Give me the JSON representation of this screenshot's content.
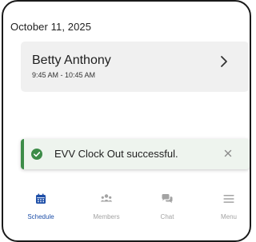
{
  "date_header": "October 11, 2025",
  "appointment": {
    "name": "Betty Anthony",
    "time": "9:45 AM - 10:45 AM",
    "chevron_icon": "chevron-right-icon"
  },
  "toast": {
    "message": "EVV Clock Out successful.",
    "status_icon": "check-circle-icon",
    "close_icon": "close-icon",
    "accent_color": "#3d8c48",
    "background_color": "#eef4ee"
  },
  "tabbar": {
    "active_color": "#1e4fa8",
    "inactive_color": "#a3a3a3",
    "items": [
      {
        "label": "Schedule",
        "icon": "calendar-icon",
        "active": true
      },
      {
        "label": "Members",
        "icon": "members-icon",
        "active": false
      },
      {
        "label": "Chat",
        "icon": "chat-icon",
        "active": false
      },
      {
        "label": "Menu",
        "icon": "menu-icon",
        "active": false
      }
    ]
  }
}
